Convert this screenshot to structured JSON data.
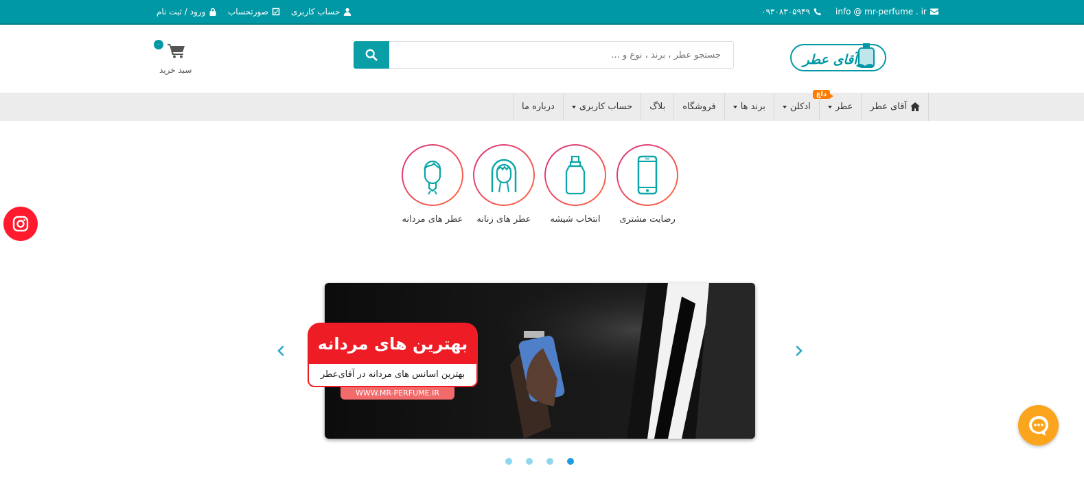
{
  "topbar": {
    "email": "info @ mr-perfume . ir",
    "phone": "۰۹۳۰۸۳۰۵۹۴۹",
    "account": "حساب کاربری",
    "invoice": "صورتحساب",
    "login": "ورود / ثبت نام"
  },
  "header": {
    "logo_text": "آقای عطر",
    "search_placeholder": "جستجو عطر ، برند ، نوع و ...",
    "cart_count": "۰",
    "cart_label": "سبد خرید"
  },
  "nav": {
    "items": [
      {
        "label": "آقای عطر"
      },
      {
        "label": "عطر",
        "badge": "داغ"
      },
      {
        "label": "ادکلن"
      },
      {
        "label": "برند ها"
      },
      {
        "label": "فروشگاه"
      },
      {
        "label": "بلاگ"
      },
      {
        "label": "حساب کاربری"
      },
      {
        "label": "درباره ما"
      }
    ]
  },
  "features": [
    {
      "label": "رضایت مشتری",
      "icon": "phone-icon"
    },
    {
      "label": "انتخاب شیشه",
      "icon": "bottle-icon"
    },
    {
      "label": "عطر های زنانه",
      "icon": "woman-icon"
    },
    {
      "label": "عطر های مردانه",
      "icon": "man-icon"
    }
  ],
  "slider": {
    "title": "بهترین های مردانه",
    "subtitle": "بهترین اسانس های مردانه در آقای‌عطر",
    "url": "WWW.MR-PERFUME.IR",
    "active_slide": 4,
    "slide_count": 4
  },
  "colors": {
    "primary": "#0098a5",
    "nav_bg": "#ececec",
    "promo_red": "#ee1c25",
    "badge_orange": "#ff7b00",
    "instagram_red": "#ff1b2d",
    "chat_yellow": "#fba51f"
  }
}
